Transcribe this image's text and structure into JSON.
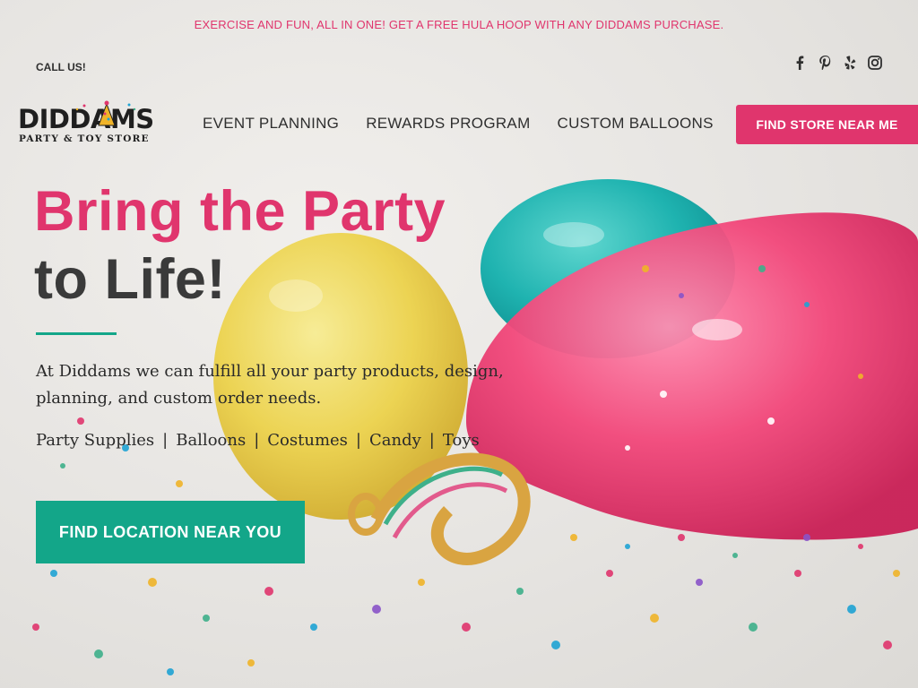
{
  "announcement": "EXERCISE AND FUN, ALL IN ONE! GET A FREE HULA HOOP WITH ANY DIDDAMS PURCHASE.",
  "call_us": "CALL US!",
  "social": [
    "facebook-icon",
    "pinterest-icon",
    "yelp-icon",
    "instagram-icon"
  ],
  "logo": {
    "word": "DIDDAMS",
    "tagline": "PARTY & TOY STORE"
  },
  "nav": [
    {
      "label": "EVENT PLANNING"
    },
    {
      "label": "REWARDS PROGRAM"
    },
    {
      "label": "CUSTOM BALLOONS"
    }
  ],
  "store_button": "FIND STORE NEAR ME",
  "hero": {
    "headline_line1": "Bring the Party",
    "headline_line2": "to Life!",
    "intro": "At Diddams we can fulfill all your party products, design, planning, and custom order needs.",
    "categories": [
      "Party Supplies",
      "Balloons",
      "Costumes",
      "Candy",
      "Toys"
    ],
    "cta": "FIND LOCATION NEAR YOU"
  },
  "colors": {
    "brand_pink": "#e0356d",
    "brand_teal": "#13a689",
    "text_dark": "#3a3a3a"
  }
}
